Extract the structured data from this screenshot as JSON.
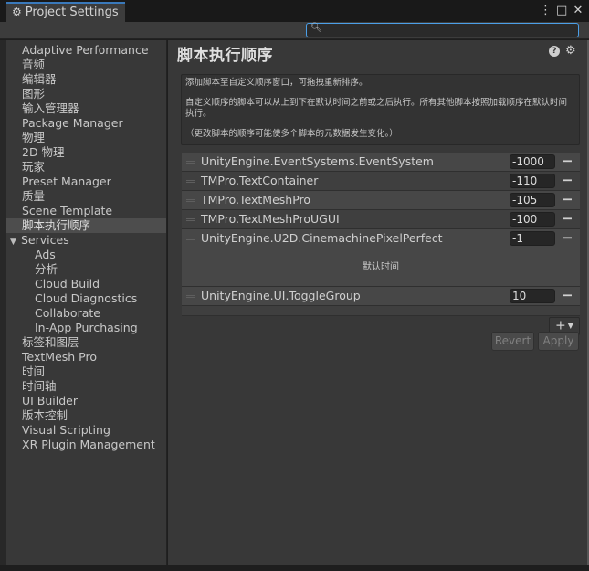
{
  "window": {
    "tab_title": "Project Settings",
    "icons": [
      "gear-icon",
      "more-vertical-icon",
      "maximize-icon",
      "close-icon"
    ]
  },
  "search": {
    "value": "",
    "placeholder": ""
  },
  "sidebar": {
    "items": [
      {
        "label": "Adaptive Performance"
      },
      {
        "label": "音频"
      },
      {
        "label": "编辑器"
      },
      {
        "label": "图形"
      },
      {
        "label": "输入管理器"
      },
      {
        "label": "Package Manager"
      },
      {
        "label": "物理"
      },
      {
        "label": "2D 物理"
      },
      {
        "label": "玩家"
      },
      {
        "label": "Preset Manager"
      },
      {
        "label": "质量"
      },
      {
        "label": "Scene Template"
      },
      {
        "label": "脚本执行顺序",
        "selected": true
      },
      {
        "label": "Services",
        "expanded": true
      },
      {
        "label": "Ads"
      },
      {
        "label": "分析"
      },
      {
        "label": "Cloud Build"
      },
      {
        "label": "Cloud Diagnostics"
      },
      {
        "label": "Collaborate"
      },
      {
        "label": "In-App Purchasing"
      },
      {
        "label": "标签和图层"
      },
      {
        "label": "TextMesh Pro"
      },
      {
        "label": "时间"
      },
      {
        "label": "时间轴"
      },
      {
        "label": "UI Builder"
      },
      {
        "label": "版本控制"
      },
      {
        "label": "Visual Scripting"
      },
      {
        "label": "XR Plugin Management"
      }
    ]
  },
  "main": {
    "title": "脚本执行顺序",
    "help_icon_glyph": "?",
    "info": {
      "line1": "添加脚本至自定义顺序窗口，可拖拽重新排序。",
      "line2": "自定义顺序的脚本可以从上到下在默认时间之前或之后执行。所有其他脚本按照加载顺序在默认时间执行。",
      "line3": "（更改脚本的顺序可能使多个脚本的元数据发生变化。）"
    },
    "scripts_before": [
      {
        "name": "UnityEngine.EventSystems.EventSystem",
        "order": "-1000"
      },
      {
        "name": "TMPro.TextContainer",
        "order": "-110"
      },
      {
        "name": "TMPro.TextMeshPro",
        "order": "-105"
      },
      {
        "name": "TMPro.TextMeshProUGUI",
        "order": "-100"
      },
      {
        "name": "UnityEngine.U2D.CinemachinePixelPerfect",
        "order": "-1"
      }
    ],
    "default_time_label": "默认时间",
    "scripts_after": [
      {
        "name": "UnityEngine.UI.ToggleGroup",
        "order": "10"
      }
    ],
    "add_label": "+",
    "revert_label": "Revert",
    "apply_label": "Apply"
  }
}
